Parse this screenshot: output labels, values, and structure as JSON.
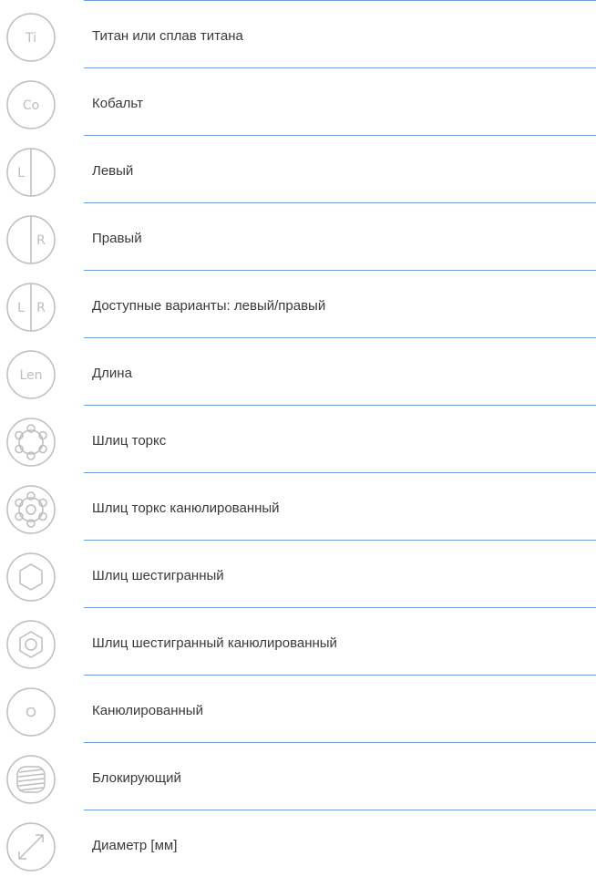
{
  "legend": {
    "items": [
      {
        "icon": "titanium-icon",
        "glyph": "Ti",
        "label": "Титан или сплав титана"
      },
      {
        "icon": "cobalt-icon",
        "glyph": "Co",
        "label": "Кобальт"
      },
      {
        "icon": "left-icon",
        "glyph": "L",
        "label": "Левый"
      },
      {
        "icon": "right-icon",
        "glyph": "R",
        "label": "Правый"
      },
      {
        "icon": "left-right-icon",
        "glyph_left": "L",
        "glyph_right": "R",
        "label": "Доступные варианты: левый/правый"
      },
      {
        "icon": "length-icon",
        "glyph": "Len",
        "label": "Длина"
      },
      {
        "icon": "torx-drive-icon",
        "label": "Шлиц торкс"
      },
      {
        "icon": "torx-cannulated-icon",
        "label": "Шлиц торкс канюлированный"
      },
      {
        "icon": "hex-drive-icon",
        "label": "Шлиц шестигранный"
      },
      {
        "icon": "hex-cannulated-icon",
        "label": "Шлиц шестигранный канюлированный"
      },
      {
        "icon": "cannulated-icon",
        "label": "Канюлированный"
      },
      {
        "icon": "locking-icon",
        "label": "Блокирующий"
      },
      {
        "icon": "diameter-icon",
        "label": "Диаметр [мм]"
      }
    ]
  },
  "colors": {
    "divider": "#6f9fd8",
    "icon_stroke": "#bdbdbd",
    "text": "#3a3a3a"
  }
}
